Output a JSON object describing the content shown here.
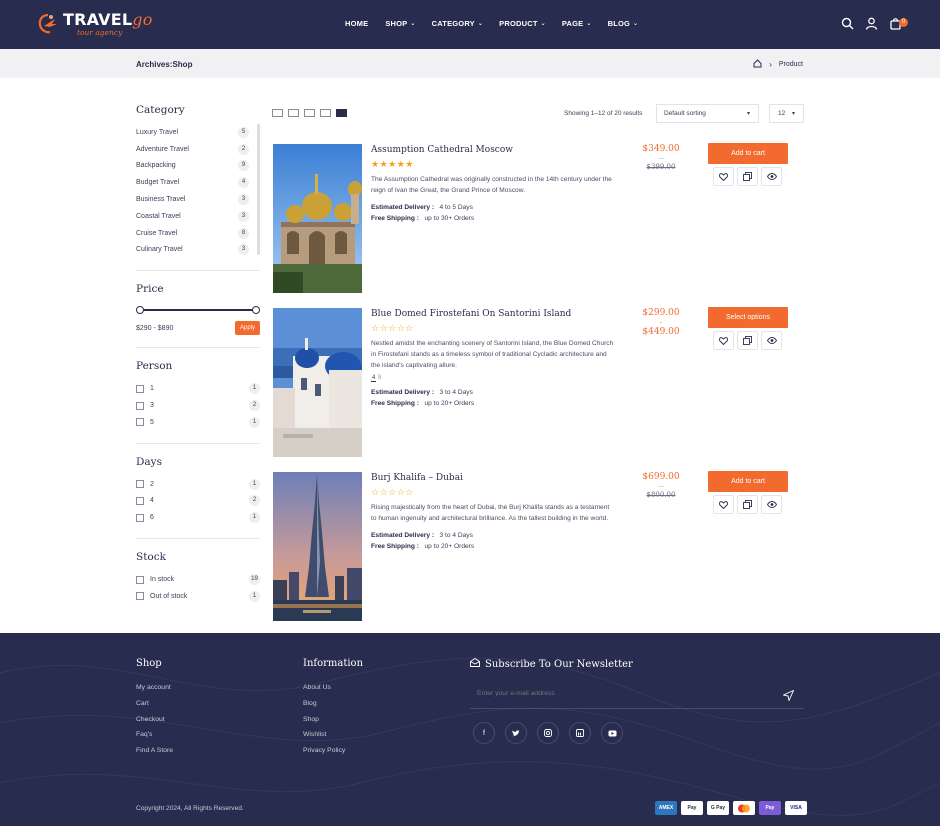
{
  "brand": {
    "name_main": "TRAVEL",
    "name_go": "go",
    "tagline": "tour agency",
    "accent": "#f26a2d",
    "navy": "#282c4e"
  },
  "nav": [
    {
      "label": "HOME",
      "has_dropdown": false
    },
    {
      "label": "SHOP",
      "has_dropdown": true
    },
    {
      "label": "CATEGORY",
      "has_dropdown": true
    },
    {
      "label": "PRODUCT",
      "has_dropdown": true
    },
    {
      "label": "PAGE",
      "has_dropdown": true
    },
    {
      "label": "BLOG",
      "has_dropdown": true
    }
  ],
  "header_icons": [
    "search-icon",
    "user-icon",
    "cart-icon"
  ],
  "cart_count": "0",
  "breadcrumb": {
    "title": "Archives:Shop",
    "current": "Product"
  },
  "sidebar": {
    "category_heading": "Category",
    "categories": [
      {
        "label": "Luxury Travel",
        "count": "5"
      },
      {
        "label": "Adventure Travel",
        "count": "2"
      },
      {
        "label": "Backpacking",
        "count": "9"
      },
      {
        "label": "Budget Travel",
        "count": "4"
      },
      {
        "label": "Business Travel",
        "count": "3"
      },
      {
        "label": "Coastal Travel",
        "count": "3"
      },
      {
        "label": "Cruise Travel",
        "count": "8"
      },
      {
        "label": "Culinary Travel",
        "count": "3"
      }
    ],
    "price_heading": "Price",
    "price_range": "$290 - $890",
    "apply_label": "Apply",
    "person_heading": "Person",
    "persons": [
      {
        "label": "1",
        "count": "1"
      },
      {
        "label": "3",
        "count": "2"
      },
      {
        "label": "5",
        "count": "1"
      }
    ],
    "days_heading": "Days",
    "days": [
      {
        "label": "2",
        "count": "1"
      },
      {
        "label": "4",
        "count": "2"
      },
      {
        "label": "6",
        "count": "1"
      }
    ],
    "stock_heading": "Stock",
    "stock": [
      {
        "label": "In stock",
        "count": "19"
      },
      {
        "label": "Out of stock",
        "count": "1"
      }
    ]
  },
  "toolbar": {
    "results_text": "Showing 1–12 of 20 results",
    "sort_value": "Default sorting",
    "per_page_value": "12"
  },
  "products": [
    {
      "title": "Assumption Cathedral Moscow",
      "rating_filled": true,
      "description": "The Assumption Cathedral was originally constructed in the 14th century under the reign of Ivan the Great, the Grand Prince of Moscow.",
      "delivery_label": "Estimated Delivery :",
      "delivery_value": "4 to 5 Days",
      "shipping_label": "Free Shipping :",
      "shipping_value": "up to 30+ Orders",
      "price_now": "$349.00",
      "price_sep": "—",
      "price_old": "$399.00",
      "button_label": "Add to cart"
    },
    {
      "title": "Blue Domed Firostefani On Santorini Island",
      "rating_filled": false,
      "description": "Nestled amidst the enchanting scenery of Santorini Island, the Blue Domed Church in Firostefani stands as a timeless symbol of traditional Cycladic architecture and the island's captivating allure.",
      "extra_a": "4",
      "extra_b": "8",
      "delivery_label": "Estimated Delivery :",
      "delivery_value": "3 to 4 Days",
      "shipping_label": "Free Shipping :",
      "shipping_value": "up to 20+ Orders",
      "price_now": "$299.00",
      "price_sep": "–",
      "price_old": "$449.00",
      "button_label": "Select options"
    },
    {
      "title": "Burj Khalifa – Dubai",
      "rating_filled": false,
      "description": "Rising majestically from the heart of Dubai, the Burj Khalifa stands as a testament to human ingenuity and architectural brilliance. As the tallest building in the world.",
      "delivery_label": "Estimated Delivery :",
      "delivery_value": "3 to 4 Days",
      "shipping_label": "Free Shipping :",
      "shipping_value": "up to 20+ Orders",
      "price_now": "$699.00",
      "price_sep": "—",
      "price_old": "$800.00",
      "button_label": "Add to cart"
    }
  ],
  "footer": {
    "shop_heading": "Shop",
    "shop_links": [
      "My account",
      "Cart",
      "Checkout",
      "Faq's",
      "Find A Store"
    ],
    "info_heading": "Information",
    "info_links": [
      "About Us",
      "Blog",
      "Shop",
      "Wishlist",
      "Privacy Policy"
    ],
    "newsletter_heading": "Subscribe To Our Newsletter",
    "newsletter_placeholder": "Enter your e-mail address",
    "social": [
      "facebook-icon",
      "twitter-icon",
      "instagram-icon",
      "linkedin-icon",
      "youtube-icon"
    ],
    "copyright": "Copyright 2024, All Rights Reserved.",
    "payments": [
      "AMEX",
      "Pay",
      "G Pay",
      "",
      "Pay",
      "VISA"
    ]
  }
}
